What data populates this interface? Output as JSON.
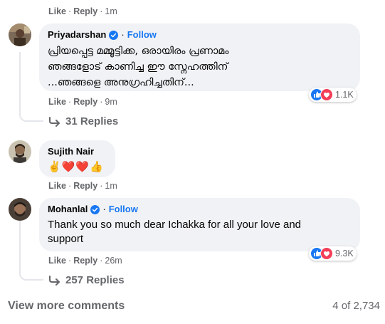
{
  "top_actions": {
    "like": "Like",
    "reply": "Reply",
    "time": "1m"
  },
  "comments": [
    {
      "author": "Priyadarshan",
      "follow": "Follow",
      "lines": [
        "പ്രിയപ്പെട്ട മമ്മൂട്ടിക്ക, ഒരായിരം പ്രണാമം",
        "ഞങ്ങളോട് കാണിച്ച ഈ സ്നേഹത്തിന്",
        "...ഞങ്ങളെ അനുഗ്രഹിച്ചതിന്..."
      ],
      "reaction_count": "1.1K",
      "actions": {
        "like": "Like",
        "reply": "Reply",
        "time": "9m"
      },
      "replies": "31 Replies"
    },
    {
      "author": "Sujith Nair",
      "text": "✌️❤️❤️👍",
      "actions": {
        "like": "Like",
        "reply": "Reply",
        "time": "1m"
      }
    },
    {
      "author": "Mohanlal",
      "follow": "Follow",
      "lines": [
        "Thank you so much dear Ichakka for all your love and",
        "support"
      ],
      "reaction_count": "9.3K",
      "actions": {
        "like": "Like",
        "reply": "Reply",
        "time": "26m"
      },
      "replies": "257 Replies"
    }
  ],
  "footer": {
    "view_more": "View more comments",
    "page_count": "4 of 2,734"
  },
  "colors": {
    "accent": "#1877f2",
    "bubble": "#f0f2f5",
    "muted": "#65676b",
    "love": "#f33e58"
  }
}
